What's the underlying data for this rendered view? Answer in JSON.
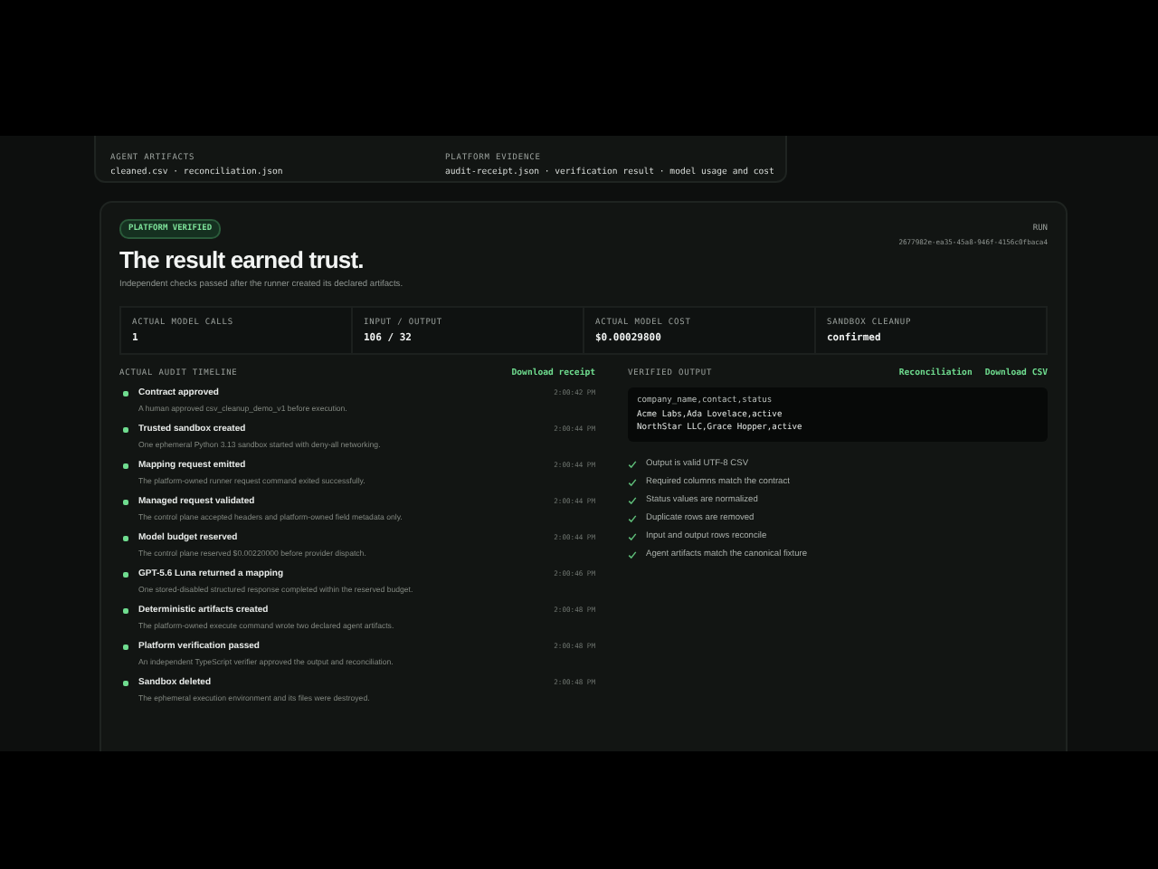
{
  "artifacts_card": {
    "sections": [
      {
        "label": "AGENT ARTIFACTS",
        "value": "cleaned.csv · reconciliation.json"
      },
      {
        "label": "PLATFORM EVIDENCE",
        "value": "audit-receipt.json · verification result · model usage and cost"
      }
    ]
  },
  "result": {
    "badge": "PLATFORM VERIFIED",
    "title": "The result earned trust.",
    "subtitle": "Independent checks passed after the runner created its declared artifacts.",
    "run_label": "RUN",
    "run_id": "2677982e-ea35-45a8-946f-4156c0fbaca4",
    "stats": [
      {
        "label": "ACTUAL MODEL CALLS",
        "value": "1"
      },
      {
        "label": "INPUT / OUTPUT",
        "value": "106 / 32"
      },
      {
        "label": "ACTUAL MODEL COST",
        "value": "$0.00029800"
      },
      {
        "label": "SANDBOX CLEANUP",
        "value": "confirmed"
      }
    ],
    "timeline": {
      "title": "ACTUAL AUDIT TIMELINE",
      "link": "Download receipt",
      "events": [
        {
          "title": "Contract approved",
          "description": "A human approved csv_cleanup_demo_v1 before execution.",
          "time": "2:00:42 PM"
        },
        {
          "title": "Trusted sandbox created",
          "description": "One ephemeral Python 3.13 sandbox started with deny-all networking.",
          "time": "2:00:44 PM"
        },
        {
          "title": "Mapping request emitted",
          "description": "The platform-owned runner request command exited successfully.",
          "time": "2:00:44 PM"
        },
        {
          "title": "Managed request validated",
          "description": "The control plane accepted headers and platform-owned field metadata only.",
          "time": "2:00:44 PM"
        },
        {
          "title": "Model budget reserved",
          "description": "The control plane reserved $0.00220000 before provider dispatch.",
          "time": "2:00:44 PM"
        },
        {
          "title": "GPT-5.6 Luna returned a mapping",
          "description": "One stored-disabled structured response completed within the reserved budget.",
          "time": "2:00:46 PM"
        },
        {
          "title": "Deterministic artifacts created",
          "description": "The platform-owned execute command wrote two declared agent artifacts.",
          "time": "2:00:48 PM"
        },
        {
          "title": "Platform verification passed",
          "description": "An independent TypeScript verifier approved the output and reconciliation.",
          "time": "2:00:48 PM"
        },
        {
          "title": "Sandbox deleted",
          "description": "The ephemeral execution environment and its files were destroyed.",
          "time": "2:00:48 PM"
        }
      ]
    },
    "output": {
      "title": "VERIFIED OUTPUT",
      "links": [
        "Reconciliation",
        "Download CSV"
      ],
      "csv_lines": [
        "company_name,contact,status",
        "Acme Labs,Ada Lovelace,active",
        "NorthStar LLC,Grace Hopper,active"
      ],
      "checks": [
        {
          "text": "Output is valid UTF-8 CSV",
          "passed": true
        },
        {
          "text": "Required columns match the contract",
          "passed": true
        },
        {
          "text": "Status values are normalized",
          "passed": true
        },
        {
          "text": "Duplicate rows are removed",
          "passed": true
        },
        {
          "text": "Input and output rows reconcile",
          "passed": true
        },
        {
          "text": "Agent artifacts match the canonical fixture",
          "passed": true
        }
      ]
    }
  }
}
